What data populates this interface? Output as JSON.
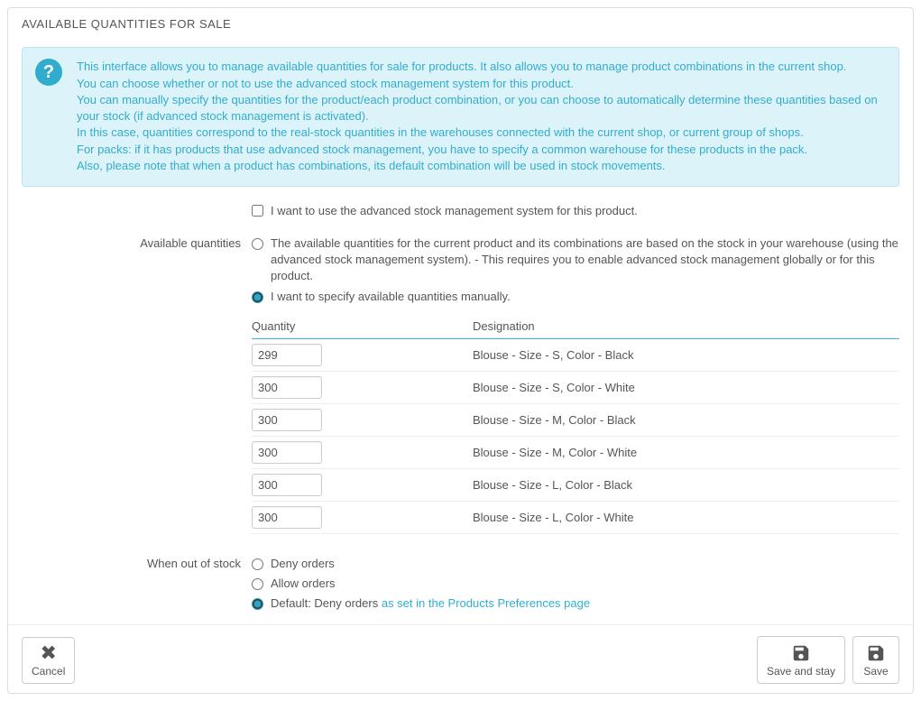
{
  "panel": {
    "title": "AVAILABLE QUANTITIES FOR SALE"
  },
  "info": {
    "lines": [
      "This interface allows you to manage available quantities for sale for products. It also allows you to manage product combinations in the current shop.",
      "You can choose whether or not to use the advanced stock management system for this product.",
      "You can manually specify the quantities for the product/each product combination, or you can choose to automatically determine these quantities based on your stock (if advanced stock management is activated).",
      "In this case, quantities correspond to the real-stock quantities in the warehouses connected with the current shop, or current group of shops.",
      "For packs: if it has products that use advanced stock management, you have to specify a common warehouse for these products in the pack.",
      "Also, please note that when a product has combinations, its default combination will be used in stock movements."
    ]
  },
  "asm_checkbox_label": "I want to use the advanced stock management system for this product.",
  "labels": {
    "available_quantities": "Available quantities",
    "when_out": "When out of stock"
  },
  "depends_on_stock": {
    "based_on_warehouse": "The available quantities for the current product and its combinations are based on the stock in your warehouse (using the advanced stock management system).  - This requires you to enable advanced stock management globally or for this product.",
    "manual": "I want to specify available quantities manually."
  },
  "table_headers": {
    "qty": "Quantity",
    "designation": "Designation"
  },
  "rows": [
    {
      "qty": "299",
      "name": "Blouse - Size - S, Color - Black"
    },
    {
      "qty": "300",
      "name": "Blouse - Size - S, Color - White"
    },
    {
      "qty": "300",
      "name": "Blouse - Size - M, Color - Black"
    },
    {
      "qty": "300",
      "name": "Blouse - Size - M, Color - White"
    },
    {
      "qty": "300",
      "name": "Blouse - Size - L, Color - Black"
    },
    {
      "qty": "300",
      "name": "Blouse - Size - L, Color - White"
    }
  ],
  "oos": {
    "deny": "Deny orders",
    "allow": "Allow orders",
    "default_pre": "Default: Deny orders ",
    "default_link": "as set in the Products Preferences page"
  },
  "buttons": {
    "cancel": "Cancel",
    "save_stay": "Save and stay",
    "save": "Save"
  }
}
